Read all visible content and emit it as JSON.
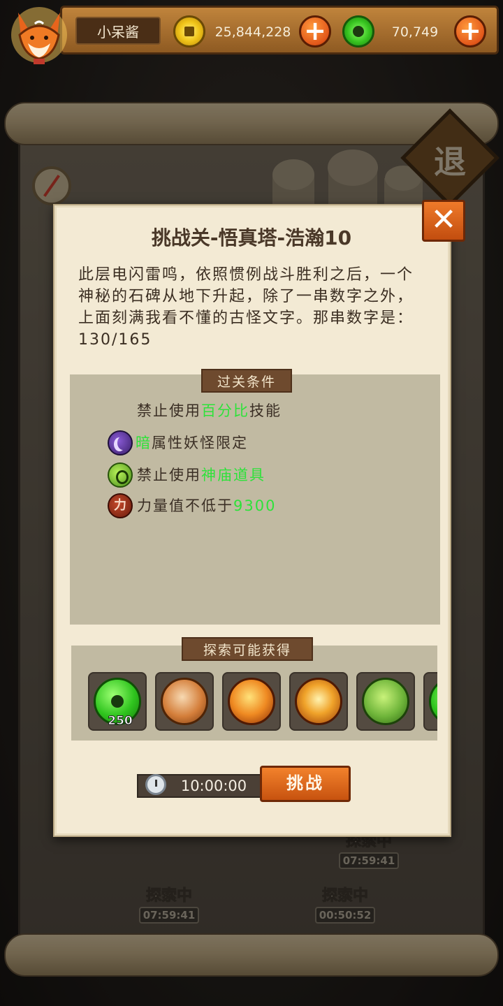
{
  "hud": {
    "player_name": "小呆酱",
    "gold_amount": "25,844,228",
    "jade_amount": "70,749",
    "plus_label": "+"
  },
  "background": {
    "retreat_label": "退",
    "exploring": [
      {
        "status": "探索中",
        "time": "07:59:41"
      },
      {
        "status": "探索中",
        "time": "07:59:41"
      },
      {
        "status": "探索中",
        "time": "00:50:52"
      }
    ]
  },
  "dialog": {
    "title": "挑战关-悟真塔-浩瀚10",
    "description": "此层电闪雷鸣，依照惯例战斗胜利之后，一个神秘的石碑从地下升起，除了一串数字之外，上面刻满我看不懂的古怪文字。那串数字是：130/165",
    "close_label": "✕",
    "conditions_tag": "过关条件",
    "conditions": [
      {
        "pre": "禁止使用",
        "hl": "百分比",
        "post": "技能",
        "icon": "none"
      },
      {
        "pre": "",
        "hl": "暗",
        "post": "属性妖怪限定",
        "icon": "dark-moon-icon"
      },
      {
        "pre": "禁止使用",
        "hl": "神庙道具",
        "post": "",
        "icon": "temple-item-icon"
      },
      {
        "pre": "力量值不低于",
        "hl": "9300",
        "post": "",
        "icon": "power-icon"
      }
    ],
    "power_icon_glyph": "力",
    "reward_tag": "探索可能获得",
    "rewards": [
      {
        "icon": "jade-coin-icon",
        "count": "250"
      },
      {
        "icon": "swirl-orb-icon",
        "count": ""
      },
      {
        "icon": "flame-orb-icon",
        "count": ""
      },
      {
        "icon": "star-orb-icon",
        "count": ""
      },
      {
        "icon": "clover-orb-icon",
        "count": ""
      }
    ],
    "timer": "10:00:00",
    "challenge_label": "挑战"
  },
  "colors": {
    "highlight": "#2ee23a",
    "button_orange": "#e2571a",
    "parchment": "#f3ead4"
  }
}
